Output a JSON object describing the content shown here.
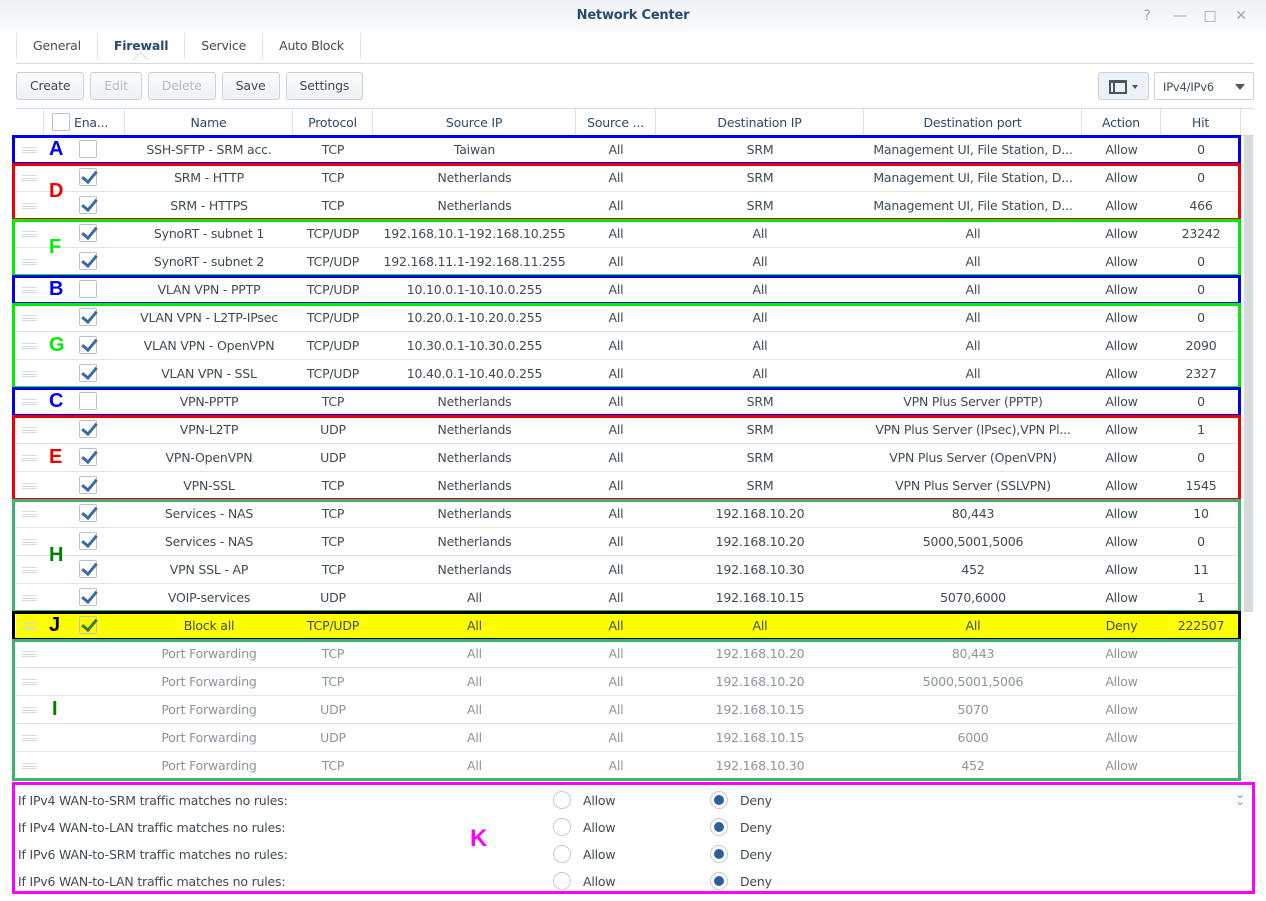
{
  "window": {
    "title": "Network Center",
    "controls": [
      {
        "name": "help-icon",
        "glyph": "?"
      },
      {
        "name": "minimize-icon",
        "glyph": "—"
      },
      {
        "name": "maximize-icon",
        "glyph": "□"
      },
      {
        "name": "close-icon",
        "glyph": "✕"
      }
    ]
  },
  "tabs": [
    {
      "label": "General",
      "active": false
    },
    {
      "label": "Firewall",
      "active": true
    },
    {
      "label": "Service",
      "active": false
    },
    {
      "label": "Auto Block",
      "active": false
    }
  ],
  "toolbar": {
    "create": "Create",
    "edit": "Edit",
    "delete": "Delete",
    "save": "Save",
    "settings": "Settings",
    "view_icon": "layout-panel-icon",
    "ip_filter": "IPv4/IPv6"
  },
  "columns": {
    "enabled": "Ena...",
    "name": "Name",
    "protocol": "Protocol",
    "source_ip": "Source IP",
    "source_port": "Source ...",
    "destination_ip": "Destination IP",
    "destination_port": "Destination port",
    "action": "Action",
    "hit": "Hit"
  },
  "rules": [
    {
      "enabled": false,
      "name": "SSH-SFTP - SRM acc.",
      "protocol": "TCP",
      "source_ip": "Taiwan",
      "source_port": "All",
      "destination_ip": "SRM",
      "destination_port": "Management UI, File Station, D...",
      "action": "Allow",
      "hit": "0"
    },
    {
      "enabled": true,
      "name": "SRM - HTTP",
      "protocol": "TCP",
      "source_ip": "Netherlands",
      "source_port": "All",
      "destination_ip": "SRM",
      "destination_port": "Management UI, File Station, D...",
      "action": "Allow",
      "hit": "0"
    },
    {
      "enabled": true,
      "name": "SRM - HTTPS",
      "protocol": "TCP",
      "source_ip": "Netherlands",
      "source_port": "All",
      "destination_ip": "SRM",
      "destination_port": "Management UI, File Station, D...",
      "action": "Allow",
      "hit": "466"
    },
    {
      "enabled": true,
      "name": "SynoRT - subnet 1",
      "protocol": "TCP/UDP",
      "source_ip": "192.168.10.1-192.168.10.255",
      "source_port": "All",
      "destination_ip": "All",
      "destination_port": "All",
      "action": "Allow",
      "hit": "23242"
    },
    {
      "enabled": true,
      "name": "SynoRT - subnet 2",
      "protocol": "TCP/UDP",
      "source_ip": "192.168.11.1-192.168.11.255",
      "source_port": "All",
      "destination_ip": "All",
      "destination_port": "All",
      "action": "Allow",
      "hit": "0"
    },
    {
      "enabled": false,
      "name": "VLAN VPN - PPTP",
      "protocol": "TCP/UDP",
      "source_ip": "10.10.0.1-10.10.0.255",
      "source_port": "All",
      "destination_ip": "All",
      "destination_port": "All",
      "action": "Allow",
      "hit": "0"
    },
    {
      "enabled": true,
      "name": "VLAN VPN - L2TP-IPsec",
      "protocol": "TCP/UDP",
      "source_ip": "10.20.0.1-10.20.0.255",
      "source_port": "All",
      "destination_ip": "All",
      "destination_port": "All",
      "action": "Allow",
      "hit": "0"
    },
    {
      "enabled": true,
      "name": "VLAN VPN - OpenVPN",
      "protocol": "TCP/UDP",
      "source_ip": "10.30.0.1-10.30.0.255",
      "source_port": "All",
      "destination_ip": "All",
      "destination_port": "All",
      "action": "Allow",
      "hit": "2090"
    },
    {
      "enabled": true,
      "name": "VLAN VPN - SSL",
      "protocol": "TCP/UDP",
      "source_ip": "10.40.0.1-10.40.0.255",
      "source_port": "All",
      "destination_ip": "All",
      "destination_port": "All",
      "action": "Allow",
      "hit": "2327"
    },
    {
      "enabled": false,
      "name": "VPN-PPTP",
      "protocol": "TCP",
      "source_ip": "Netherlands",
      "source_port": "All",
      "destination_ip": "SRM",
      "destination_port": "VPN Plus Server (PPTP)",
      "action": "Allow",
      "hit": "0"
    },
    {
      "enabled": true,
      "name": "VPN-L2TP",
      "protocol": "UDP",
      "source_ip": "Netherlands",
      "source_port": "All",
      "destination_ip": "SRM",
      "destination_port": "VPN Plus Server (IPsec),VPN Pl...",
      "action": "Allow",
      "hit": "1"
    },
    {
      "enabled": true,
      "name": "VPN-OpenVPN",
      "protocol": "UDP",
      "source_ip": "Netherlands",
      "source_port": "All",
      "destination_ip": "SRM",
      "destination_port": "VPN Plus Server (OpenVPN)",
      "action": "Allow",
      "hit": "0"
    },
    {
      "enabled": true,
      "name": "VPN-SSL",
      "protocol": "TCP",
      "source_ip": "Netherlands",
      "source_port": "All",
      "destination_ip": "SRM",
      "destination_port": "VPN Plus Server (SSLVPN)",
      "action": "Allow",
      "hit": "1545"
    },
    {
      "enabled": true,
      "name": "Services - NAS",
      "protocol": "TCP",
      "source_ip": "Netherlands",
      "source_port": "All",
      "destination_ip": "192.168.10.20",
      "destination_port": "80,443",
      "action": "Allow",
      "hit": "10"
    },
    {
      "enabled": true,
      "name": "Services - NAS",
      "protocol": "TCP",
      "source_ip": "Netherlands",
      "source_port": "All",
      "destination_ip": "192.168.10.20",
      "destination_port": "5000,5001,5006",
      "action": "Allow",
      "hit": "0"
    },
    {
      "enabled": true,
      "name": "VPN SSL - AP",
      "protocol": "TCP",
      "source_ip": "Netherlands",
      "source_port": "All",
      "destination_ip": "192.168.10.30",
      "destination_port": "452",
      "action": "Allow",
      "hit": "11"
    },
    {
      "enabled": true,
      "name": "VOIP-services",
      "protocol": "UDP",
      "source_ip": "All",
      "source_port": "All",
      "destination_ip": "192.168.10.15",
      "destination_port": "5070,6000",
      "action": "Allow",
      "hit": "1"
    },
    {
      "enabled": true,
      "name": "Block all",
      "protocol": "TCP/UDP",
      "source_ip": "All",
      "source_port": "All",
      "destination_ip": "All",
      "destination_port": "All",
      "action": "Deny",
      "hit": "222507",
      "highlight": "#ffff00"
    },
    {
      "enabled": null,
      "name": "Port Forwarding",
      "protocol": "TCP",
      "source_ip": "All",
      "source_port": "All",
      "destination_ip": "192.168.10.20",
      "destination_port": "80,443",
      "action": "Allow",
      "hit": "",
      "system": true
    },
    {
      "enabled": null,
      "name": "Port Forwarding",
      "protocol": "TCP",
      "source_ip": "All",
      "source_port": "All",
      "destination_ip": "192.168.10.20",
      "destination_port": "5000,5001,5006",
      "action": "Allow",
      "hit": "",
      "system": true
    },
    {
      "enabled": null,
      "name": "Port Forwarding",
      "protocol": "UDP",
      "source_ip": "All",
      "source_port": "All",
      "destination_ip": "192.168.10.15",
      "destination_port": "5070",
      "action": "Allow",
      "hit": "",
      "system": true
    },
    {
      "enabled": null,
      "name": "Port Forwarding",
      "protocol": "UDP",
      "source_ip": "All",
      "source_port": "All",
      "destination_ip": "192.168.10.15",
      "destination_port": "6000",
      "action": "Allow",
      "hit": "",
      "system": true
    },
    {
      "enabled": null,
      "name": "Port Forwarding",
      "protocol": "TCP",
      "source_ip": "All",
      "source_port": "All",
      "destination_ip": "192.168.10.30",
      "destination_port": "452",
      "action": "Allow",
      "hit": "",
      "system": true
    }
  ],
  "annotations": [
    {
      "letter": "A",
      "color": "#0000ee",
      "first_row": 0,
      "row_count": 1
    },
    {
      "letter": "D",
      "color": "#ee0000",
      "first_row": 1,
      "row_count": 2
    },
    {
      "letter": "F",
      "color": "#00ee00",
      "first_row": 3,
      "row_count": 2
    },
    {
      "letter": "B",
      "color": "#0000ee",
      "first_row": 5,
      "row_count": 1
    },
    {
      "letter": "G",
      "color": "#00ee00",
      "first_row": 6,
      "row_count": 3
    },
    {
      "letter": "C",
      "color": "#0000ee",
      "first_row": 9,
      "row_count": 1
    },
    {
      "letter": "E",
      "color": "#ee0000",
      "first_row": 10,
      "row_count": 3
    },
    {
      "letter": "H",
      "color": "#3cb371",
      "letter_color": "#008000",
      "first_row": 13,
      "row_count": 4
    },
    {
      "letter": "J",
      "color": "#000000",
      "first_row": 17,
      "row_count": 1
    },
    {
      "letter": "I",
      "color": "#3cb371",
      "letter_color": "#008000",
      "first_row": 18,
      "row_count": 5
    },
    {
      "letter": "K",
      "color": "#ff00ff"
    }
  ],
  "default_policies": [
    {
      "label": "If IPv4 WAN-to-SRM traffic matches no rules:",
      "allow": "Allow",
      "deny": "Deny",
      "selected": "Deny"
    },
    {
      "label": "If IPv4 WAN-to-LAN traffic matches no rules:",
      "allow": "Allow",
      "deny": "Deny",
      "selected": "Deny"
    },
    {
      "label": "If IPv6 WAN-to-SRM traffic matches no rules:",
      "allow": "Allow",
      "deny": "Deny",
      "selected": "Deny"
    },
    {
      "label": "If IPv6 WAN-to-LAN traffic matches no rules:",
      "allow": "Allow",
      "deny": "Deny",
      "selected": "Deny"
    }
  ],
  "policy_expand_icon": "double-chevron-down-icon"
}
